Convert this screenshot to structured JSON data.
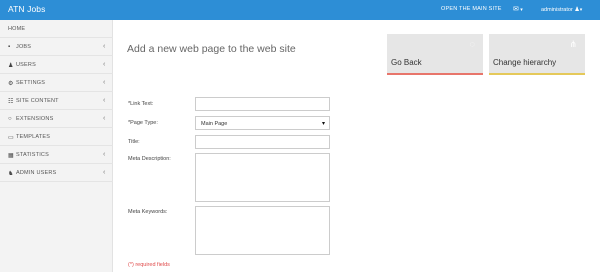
{
  "topbar": {
    "brand": "ATN Jobs",
    "main_site_link": "OPEN THE MAIN SITE",
    "mail_icon": "envelope-icon",
    "user_label": "administrator",
    "user_icon": "user-icon"
  },
  "sidebar": {
    "items": [
      {
        "label": "HOME",
        "icon": "",
        "has_chevron": false
      },
      {
        "label": "JOBS",
        "icon": "briefcase-icon",
        "has_chevron": true
      },
      {
        "label": "USERS",
        "icon": "user-icon",
        "has_chevron": true
      },
      {
        "label": "SETTINGS",
        "icon": "cogs-icon",
        "has_chevron": true
      },
      {
        "label": "SITE CONTENT",
        "icon": "sitemap-icon",
        "has_chevron": true
      },
      {
        "label": "EXTENSIONS",
        "icon": "circle-icon",
        "has_chevron": true
      },
      {
        "label": "TEMPLATES",
        "icon": "template-icon",
        "has_chevron": false
      },
      {
        "label": "STATISTICS",
        "icon": "chart-icon",
        "has_chevron": true
      },
      {
        "label": "ADMIN USERS",
        "icon": "users-icon",
        "has_chevron": true
      }
    ]
  },
  "main": {
    "title": "Add a new web page to the web site",
    "tiles": [
      {
        "label": "Go Back",
        "icon": "spinner-icon",
        "accent": "#e8756b"
      },
      {
        "label": "Change hierarchy",
        "icon": "share-icon",
        "accent": "#e5c95a"
      }
    ],
    "form": {
      "link_text_label": "*Link Text:",
      "link_text_value": "",
      "page_type_label": "*Page Type:",
      "page_type_value": "Main Page",
      "title_label": "Title:",
      "title_value": "",
      "meta_description_label": "Meta Description:",
      "meta_description_value": "",
      "meta_keywords_label": "Meta Keywords:",
      "meta_keywords_value": "",
      "required_note": "(*) required fields"
    }
  },
  "colors": {
    "topbar": "#2d8ed6",
    "sidebar": "#f3f3f3",
    "tile": "#e6e6e6",
    "required": "#e04b4b"
  }
}
